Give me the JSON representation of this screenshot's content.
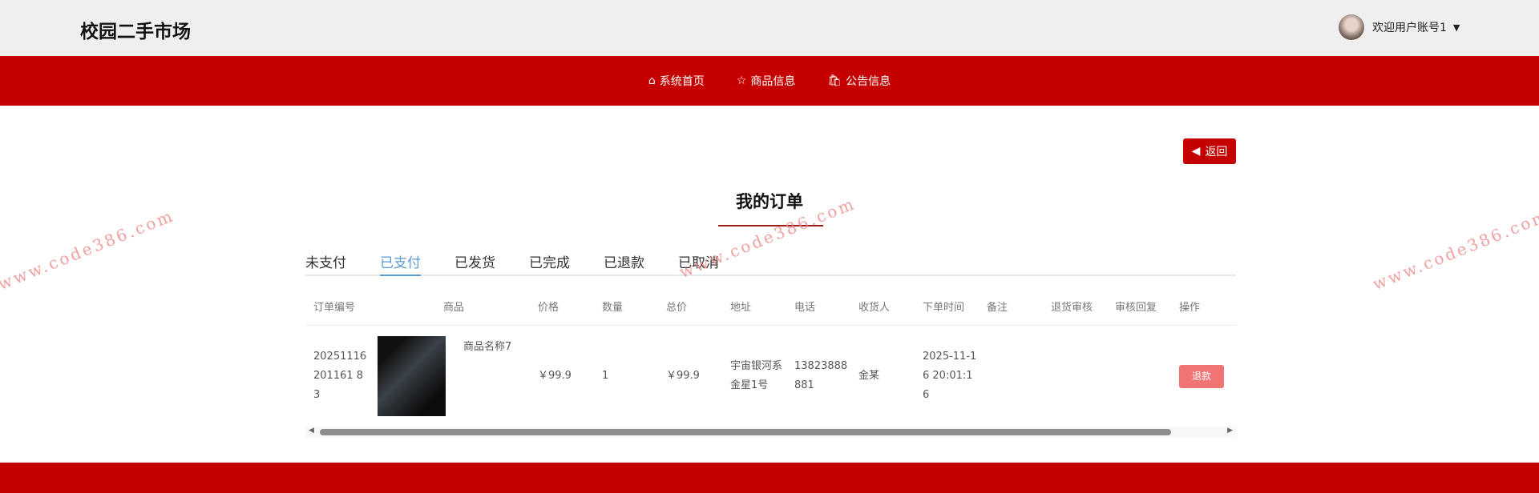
{
  "header": {
    "logo": "校园二手市场",
    "welcome": "欢迎用户账号1"
  },
  "nav": [
    {
      "label": "系统首页",
      "icon": "home-icon"
    },
    {
      "label": "商品信息",
      "icon": "star-icon"
    },
    {
      "label": "公告信息",
      "icon": "bag-icon"
    }
  ],
  "back_label": "返回",
  "page_title": "我的订单",
  "tabs": [
    "未支付",
    "已支付",
    "已发货",
    "已完成",
    "已退款",
    "已取消"
  ],
  "active_tab": "已支付",
  "table": {
    "columns": [
      "订单编号",
      "商品",
      "价格",
      "数量",
      "总价",
      "地址",
      "电话",
      "收货人",
      "下单时间",
      "备注",
      "退货审核",
      "审核回复",
      "操作"
    ],
    "rows": [
      {
        "order_no": "20251116201161 83",
        "goods": "商品名称7",
        "price": "￥99.9",
        "qty": "1",
        "total": "￥99.9",
        "address": "宇宙银河系金星1号",
        "phone": "13823888881",
        "receiver": "金某",
        "time": "2025-11-16 20:01:16",
        "remark": "",
        "return_review": "",
        "review_reply": "",
        "action": "退款"
      }
    ]
  },
  "watermark": "www.code386.com"
}
